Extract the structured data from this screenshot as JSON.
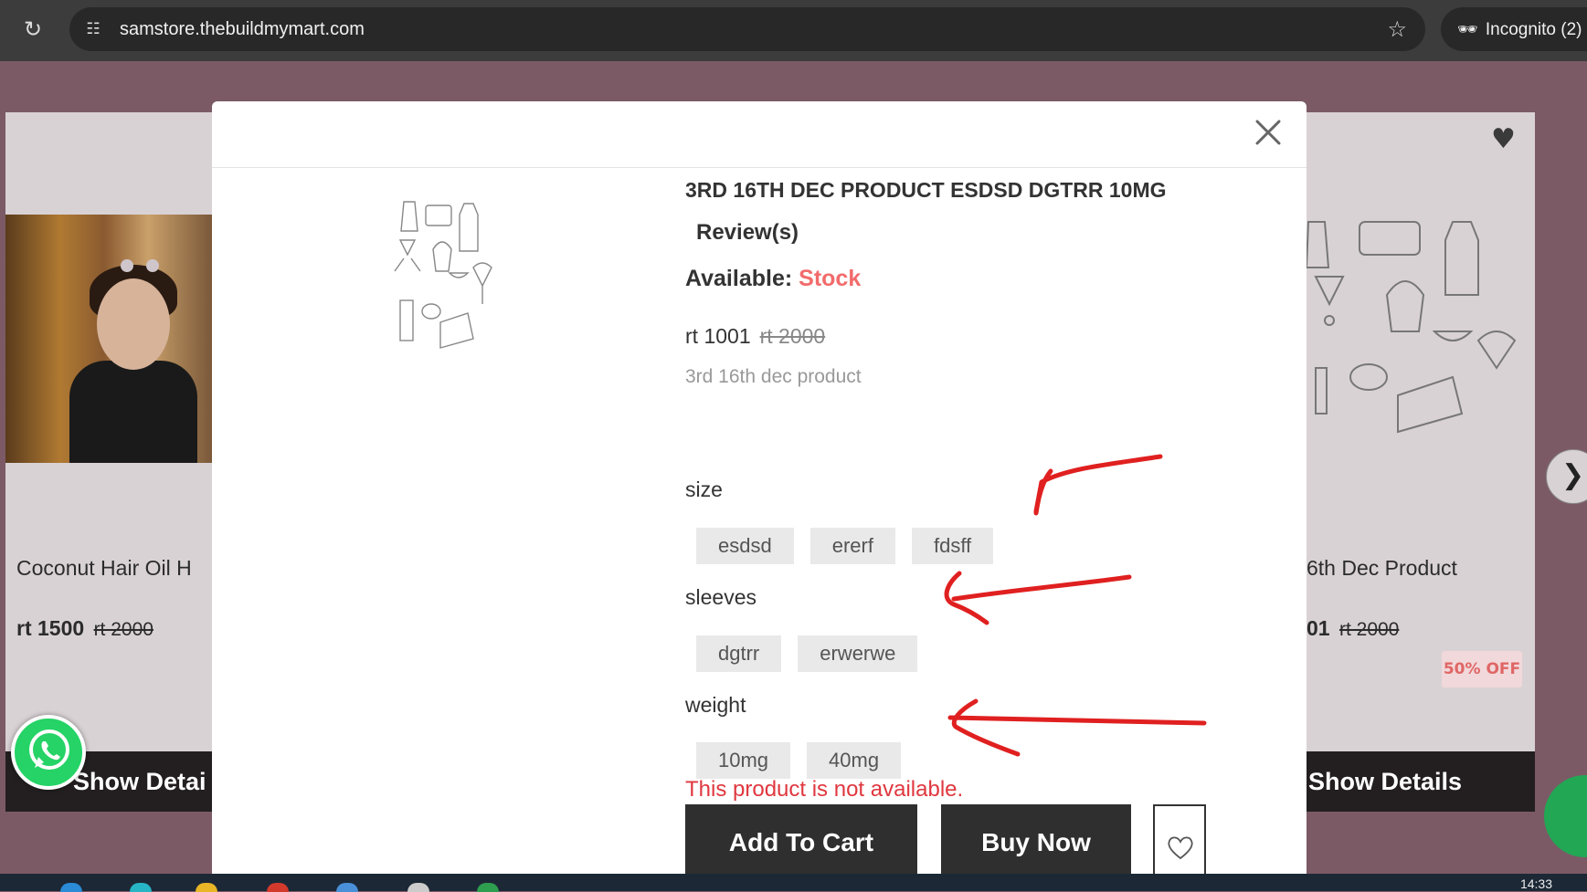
{
  "browser": {
    "url": "samstore.thebuildmymart.com",
    "incognito_label": "Incognito (2)"
  },
  "background": {
    "left_card": {
      "title": "Coconut Hair Oil H",
      "price": "rt 1500",
      "old_price": "rt 2000",
      "button": "Show Detai"
    },
    "right_card": {
      "title": "6th Dec Product",
      "price": "01",
      "old_price": "rt 2000",
      "badge": "50% OFF",
      "button": "Show Details"
    }
  },
  "modal": {
    "title": "3RD 16TH DEC PRODUCT ESDSD DGTRR 10MG",
    "reviews": "Review(s)",
    "available_label": "Available:",
    "available_value": "Stock",
    "price": "rt 1001",
    "old_price": "rt 2000",
    "description": "3rd 16th dec product",
    "options": [
      {
        "label": "size",
        "values": [
          "esdsd",
          "ererf",
          "fdsff"
        ]
      },
      {
        "label": "sleeves",
        "values": [
          "dgtrr",
          "erwerwe"
        ]
      },
      {
        "label": "weight",
        "values": [
          "10mg",
          "40mg"
        ]
      }
    ],
    "error": "This product is not available.",
    "add_to_cart": "Add To Cart",
    "buy_now": "Buy Now"
  },
  "taskbar": {
    "time": "14:33"
  },
  "colors": {
    "overlay": "#7b5a66",
    "stock": "#f26b6b",
    "error": "#e0373f",
    "button_dark": "#2f2f2f",
    "annotation_red": "#e02020"
  },
  "icons": [
    "reload-icon",
    "site-info-icon",
    "star-icon",
    "incognito-icon",
    "close-icon",
    "heart-icon",
    "chevron-right-icon",
    "whatsapp-icon",
    "chat-icon"
  ]
}
